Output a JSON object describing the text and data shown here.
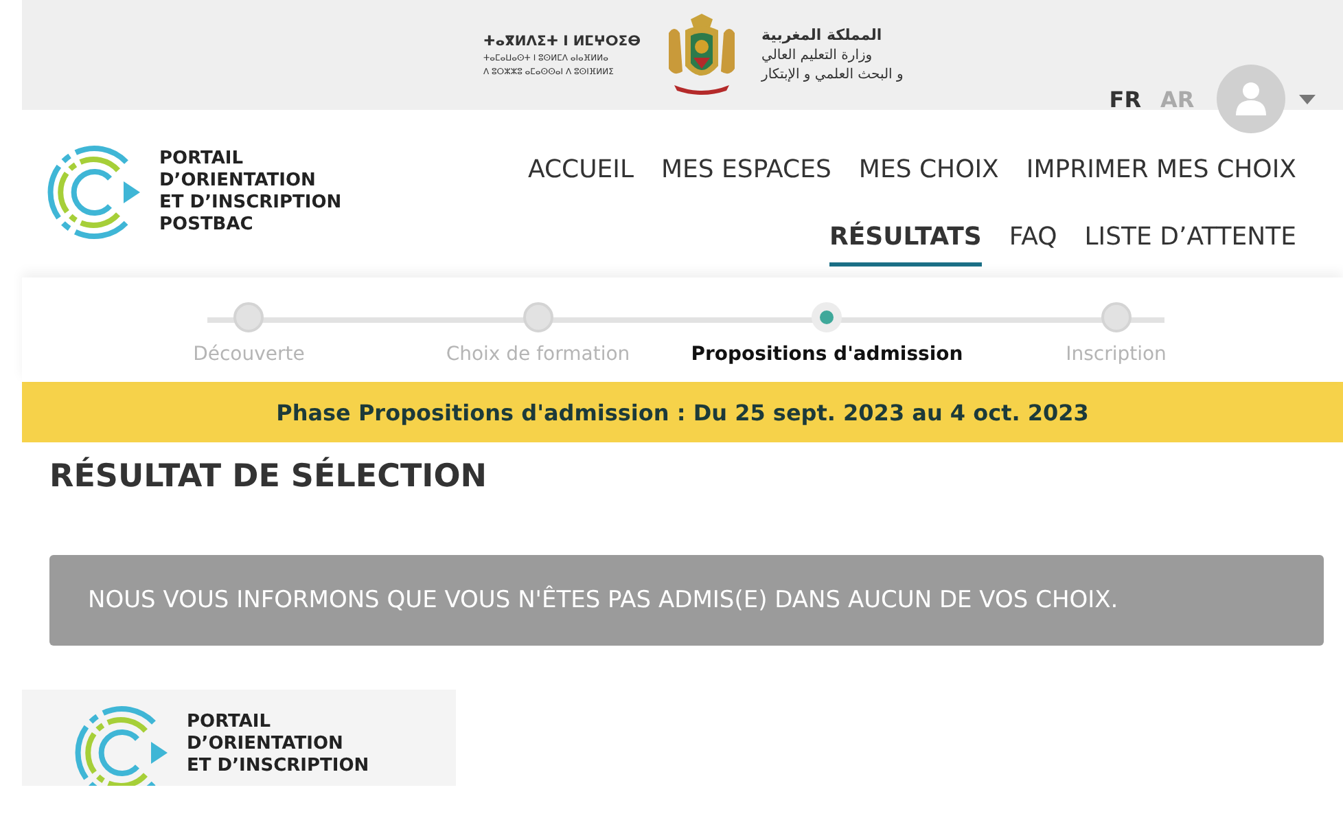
{
  "header": {
    "tifinagh": [
      "ⵜⴰⴳⵍⴷⵉⵜ ⵏ ⵍⵎⵖⵔⵉⴱ",
      "ⵜⴰⵎⴰⵡⴰⵙⵜ ⵏ ⵓⵙⵍⵎⴷ ⴰⵏⴰⴼⵍⵍⴰ",
      "ⴷ ⵓⵔⵣⵣⵓ ⴰⵎⴰⵙⵙⴰⵏ ⴷ ⵓⵙⵏⴼⵍⵍⵉ"
    ],
    "arabic": [
      "المملكة المغربية",
      "وزارة التعليم العالي",
      "و البحث العلمي و الإبتكار"
    ],
    "languages": [
      {
        "label": "FR",
        "selected": true
      },
      {
        "label": "AR",
        "selected": false
      }
    ]
  },
  "logo": {
    "lines": [
      "PORTAIL",
      "D’ORIENTATION",
      "ET D’INSCRIPTION",
      "POSTBAC"
    ]
  },
  "nav": [
    [
      {
        "label": "ACCUEIL",
        "selected": false
      },
      {
        "label": "MES ESPACES",
        "selected": false
      },
      {
        "label": "MES CHOIX",
        "selected": false
      },
      {
        "label": "IMPRIMER MES CHOIX",
        "selected": false
      }
    ],
    [
      {
        "label": "RÉSULTATS",
        "selected": true
      },
      {
        "label": "FAQ",
        "selected": false
      },
      {
        "label": "LISTE D’ATTENTE",
        "selected": false
      }
    ]
  ],
  "steps": [
    {
      "label": "Découverte",
      "selected": false
    },
    {
      "label": "Choix de formation",
      "selected": false
    },
    {
      "label": "Propositions d'admission",
      "selected": true
    },
    {
      "label": "Inscription",
      "selected": false
    }
  ],
  "phase_banner": "Phase Propositions d'admission : Du 25 sept. 2023 au 4 oct. 2023",
  "section_title": "RÉSULTAT DE SÉLECTION",
  "result_message": "NOUS VOUS INFORMONS QUE VOUS N'ÊTES PAS ADMIS(E) DANS AUCUN DE VOS CHOIX.",
  "footer_logo": {
    "lines": [
      "PORTAIL",
      "D’ORIENTATION",
      "ET D’INSCRIPTION"
    ]
  }
}
